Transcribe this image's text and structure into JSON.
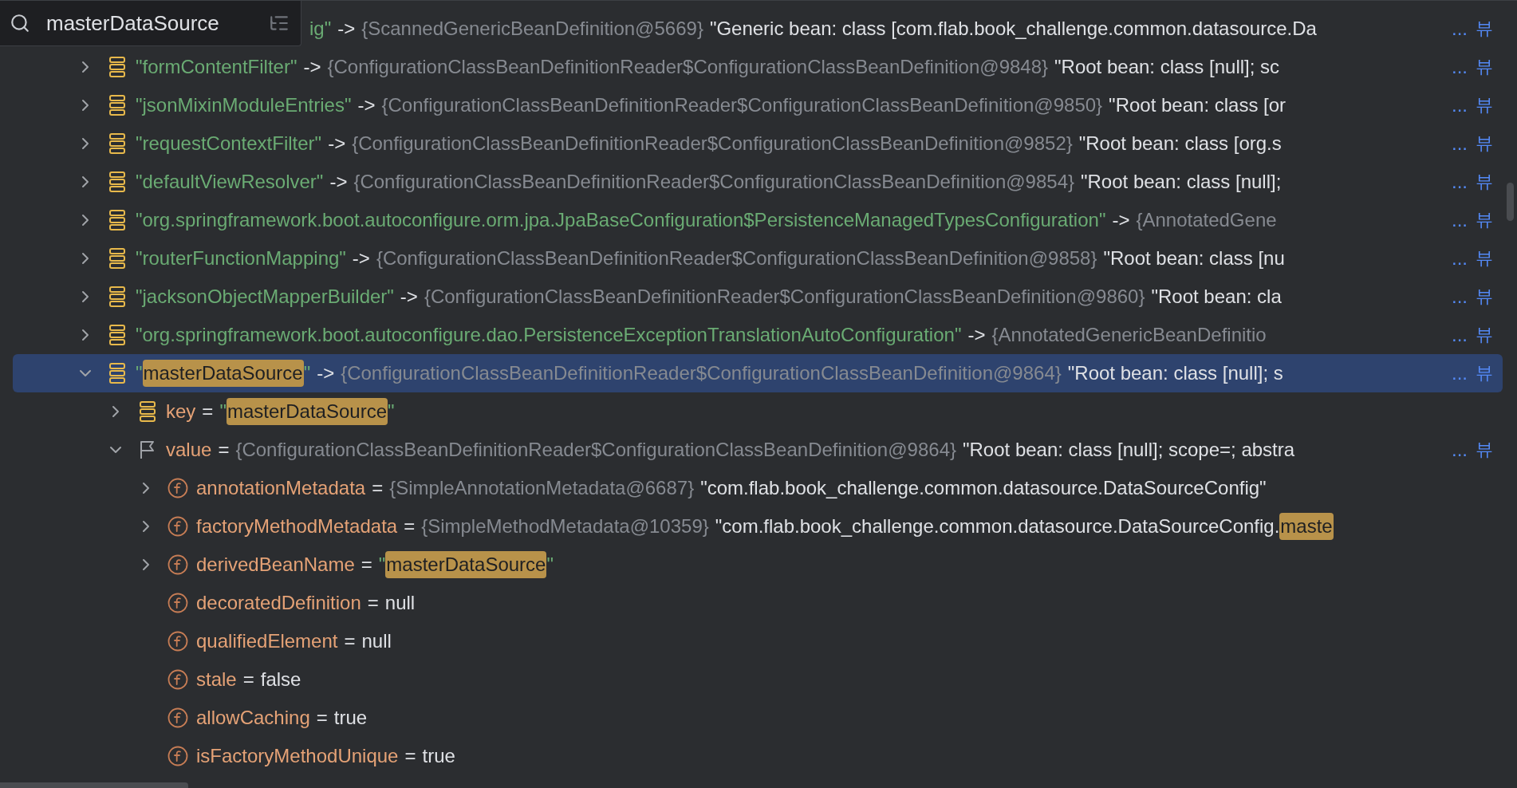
{
  "search": {
    "value": "masterDataSource"
  },
  "rows": [
    {
      "kind": "entry",
      "selected": false,
      "name": [
        {
          "text": "ig\"",
          "match": false
        }
      ],
      "separator": "->",
      "type": "{ScannedGenericBeanDefinition@5669}",
      "value": [
        {
          "text": "\"Generic bean: class [com.flab.book_challenge.common.datasource.Da",
          "match": false
        }
      ],
      "more": "...",
      "view": "뷰"
    },
    {
      "kind": "entry",
      "expanded": false,
      "selected": false,
      "name": [
        {
          "text": "\"formContentFilter\"",
          "match": false
        }
      ],
      "separator": "->",
      "type": "{ConfigurationClassBeanDefinitionReader$ConfigurationClassBeanDefinition@9848}",
      "value": [
        {
          "text": "\"Root bean: class [null]; sc",
          "match": false
        }
      ],
      "more": "...",
      "view": "뷰"
    },
    {
      "kind": "entry",
      "expanded": false,
      "selected": false,
      "name": [
        {
          "text": "\"jsonMixinModuleEntries\"",
          "match": false
        }
      ],
      "separator": "->",
      "type": "{ConfigurationClassBeanDefinitionReader$ConfigurationClassBeanDefinition@9850}",
      "value": [
        {
          "text": "\"Root bean: class [or",
          "match": false
        }
      ],
      "more": "...",
      "view": "뷰"
    },
    {
      "kind": "entry",
      "expanded": false,
      "selected": false,
      "name": [
        {
          "text": "\"requestContextFilter\"",
          "match": false
        }
      ],
      "separator": "->",
      "type": "{ConfigurationClassBeanDefinitionReader$ConfigurationClassBeanDefinition@9852}",
      "value": [
        {
          "text": "\"Root bean: class [org.s",
          "match": false
        }
      ],
      "more": "...",
      "view": "뷰"
    },
    {
      "kind": "entry",
      "expanded": false,
      "selected": false,
      "name": [
        {
          "text": "\"defaultViewResolver\"",
          "match": false
        }
      ],
      "separator": "->",
      "type": "{ConfigurationClassBeanDefinitionReader$ConfigurationClassBeanDefinition@9854}",
      "value": [
        {
          "text": "\"Root bean: class [null];",
          "match": false
        }
      ],
      "more": "...",
      "view": "뷰"
    },
    {
      "kind": "entry",
      "expanded": false,
      "selected": false,
      "name": [
        {
          "text": "\"org.springframework.boot.autoconfigure.orm.jpa.JpaBaseConfiguration$PersistenceManagedTypesConfiguration\"",
          "match": false
        }
      ],
      "separator": "->",
      "type": "{AnnotatedGene",
      "more": "...",
      "view": "뷰"
    },
    {
      "kind": "entry",
      "expanded": false,
      "selected": false,
      "name": [
        {
          "text": "\"routerFunctionMapping\"",
          "match": false
        }
      ],
      "separator": "->",
      "type": "{ConfigurationClassBeanDefinitionReader$ConfigurationClassBeanDefinition@9858}",
      "value": [
        {
          "text": "\"Root bean: class [nu",
          "match": false
        }
      ],
      "more": "...",
      "view": "뷰"
    },
    {
      "kind": "entry",
      "expanded": false,
      "selected": false,
      "name": [
        {
          "text": "\"jacksonObjectMapperBuilder\"",
          "match": false
        }
      ],
      "separator": "->",
      "type": "{ConfigurationClassBeanDefinitionReader$ConfigurationClassBeanDefinition@9860}",
      "value": [
        {
          "text": "\"Root bean: cla",
          "match": false
        }
      ],
      "more": "...",
      "view": "뷰"
    },
    {
      "kind": "entry",
      "expanded": false,
      "selected": false,
      "name": [
        {
          "text": "\"org.springframework.boot.autoconfigure.dao.PersistenceExceptionTranslationAutoConfiguration\"",
          "match": false
        }
      ],
      "separator": "->",
      "type": "{AnnotatedGenericBeanDefinitio",
      "more": "...",
      "view": "뷰"
    },
    {
      "kind": "entry",
      "expanded": true,
      "selected": true,
      "name": [
        {
          "text": "\"",
          "match": false
        },
        {
          "text": "masterDataSource",
          "match": true
        },
        {
          "text": "\"",
          "match": false
        }
      ],
      "separator": "->",
      "type": "{ConfigurationClassBeanDefinitionReader$ConfigurationClassBeanDefinition@9864}",
      "value": [
        {
          "text": "\"Root bean: class [null]; s",
          "match": false
        }
      ],
      "more": "...",
      "view": "뷰",
      "children": [
        {
          "kind": "key",
          "expanded": false,
          "selected": false,
          "name": [
            {
              "text": "key",
              "match": false
            }
          ],
          "separator": "=",
          "value": [
            {
              "text": "\"",
              "match": false
            },
            {
              "text": "masterDataSource",
              "match": true
            },
            {
              "text": "\"",
              "match": false
            }
          ]
        },
        {
          "kind": "object",
          "expanded": true,
          "selected": false,
          "name": [
            {
              "text": "value",
              "match": false
            }
          ],
          "separator": "=",
          "type": "{ConfigurationClassBeanDefinitionReader$ConfigurationClassBeanDefinition@9864}",
          "value": [
            {
              "text": "\"Root bean: class [null]; scope=; abstra",
              "match": false
            }
          ],
          "more": "...",
          "view": "뷰",
          "children": [
            {
              "kind": "field",
              "expanded": false,
              "selected": false,
              "name": [
                {
                  "text": "annotationMetadata",
                  "match": false
                }
              ],
              "separator": "=",
              "type": "{SimpleAnnotationMetadata@6687}",
              "value": [
                {
                  "text": "\"com.flab.book_challenge.common.datasource.DataSourceConfig\"",
                  "match": false
                }
              ]
            },
            {
              "kind": "field",
              "expanded": false,
              "selected": false,
              "name": [
                {
                  "text": "factoryMethodMetadata",
                  "match": false
                }
              ],
              "separator": "=",
              "type": "{SimpleMethodMetadata@10359}",
              "value": [
                {
                  "text": "\"com.flab.book_challenge.common.datasource.DataSourceConfig.",
                  "match": false
                },
                {
                  "text": "maste",
                  "match": true
                }
              ]
            },
            {
              "kind": "string-field",
              "expanded": false,
              "selected": false,
              "name": [
                {
                  "text": "derivedBeanName",
                  "match": false
                }
              ],
              "separator": "=",
              "value": [
                {
                  "text": "\"",
                  "match": false
                },
                {
                  "text": "masterDataSource",
                  "match": true
                },
                {
                  "text": "\"",
                  "match": false
                }
              ]
            },
            {
              "kind": "field",
              "selected": false,
              "name": [
                {
                  "text": "decoratedDefinition",
                  "match": false
                }
              ],
              "separator": "=",
              "value": [
                {
                  "text": "null",
                  "match": false
                }
              ]
            },
            {
              "kind": "field",
              "selected": false,
              "name": [
                {
                  "text": "qualifiedElement",
                  "match": false
                }
              ],
              "separator": "=",
              "value": [
                {
                  "text": "null",
                  "match": false
                }
              ]
            },
            {
              "kind": "field",
              "selected": false,
              "name": [
                {
                  "text": "stale",
                  "match": false
                }
              ],
              "separator": "=",
              "value": [
                {
                  "text": "false",
                  "match": false
                }
              ]
            },
            {
              "kind": "field",
              "selected": false,
              "name": [
                {
                  "text": "allowCaching",
                  "match": false
                }
              ],
              "separator": "=",
              "value": [
                {
                  "text": "true",
                  "match": false
                }
              ]
            },
            {
              "kind": "field",
              "selected": false,
              "name": [
                {
                  "text": "isFactoryMethodUnique",
                  "match": false
                }
              ],
              "separator": "=",
              "value": [
                {
                  "text": "true",
                  "match": false
                }
              ]
            }
          ]
        }
      ]
    }
  ]
}
